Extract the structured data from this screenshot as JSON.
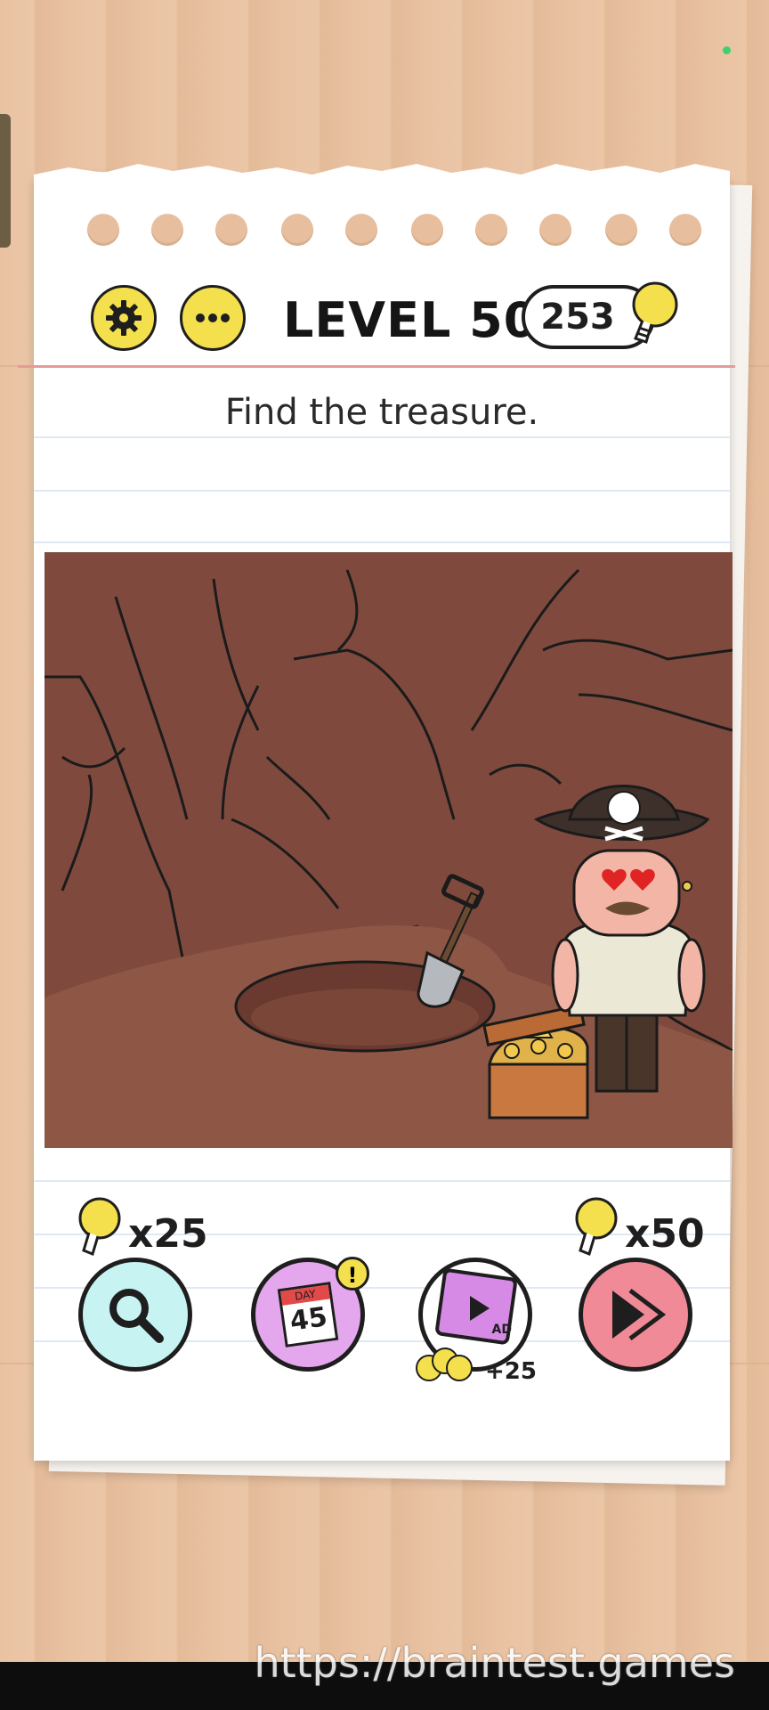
{
  "header": {
    "level_label": "LEVEL 509",
    "hint_count": "253",
    "settings_icon": "gear-icon",
    "more_icon": "more-dots-icon",
    "hint_icon": "lightbulb-icon"
  },
  "question": "Find the treasure.",
  "scene": {
    "description_icons": [
      "pirate-icon",
      "treasure-chest-icon",
      "shovel-icon",
      "hole-icon"
    ]
  },
  "actions": {
    "search": {
      "cost": "x25",
      "icon": "magnifier-icon"
    },
    "daily": {
      "day_label": "DAY",
      "day_number": "45",
      "badge": "!"
    },
    "video": {
      "ad_label": "AD",
      "reward": "+25",
      "icon": "film-play-icon"
    },
    "skip": {
      "cost": "x50",
      "icon": "skip-icon"
    }
  },
  "watermark": "https://braintest.games",
  "colors": {
    "accent_yellow": "#f4e04d",
    "search_bg": "#c8f3f3",
    "daily_bg": "#e4a7ee",
    "video_bg": "#d68ae6",
    "skip_bg": "#f08a96",
    "scene_bg": "#7f4a3d"
  }
}
